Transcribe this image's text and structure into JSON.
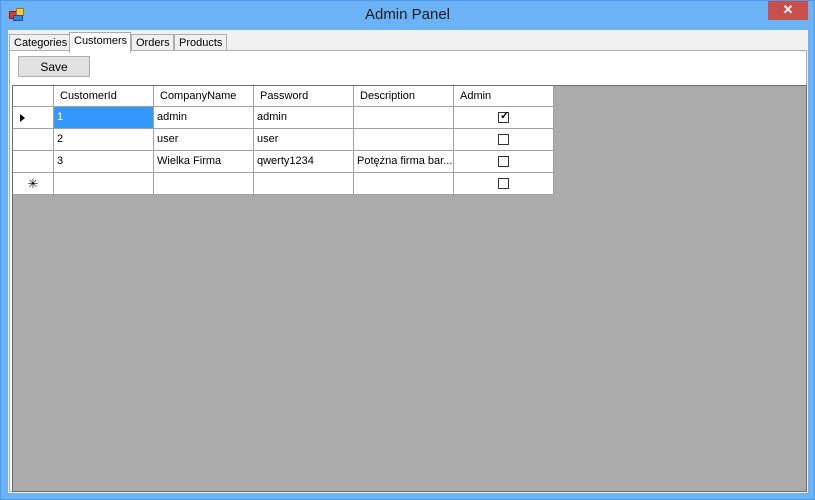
{
  "window": {
    "title": "Admin Panel",
    "close_glyph": "✕"
  },
  "tabs": [
    {
      "label": "Categories"
    },
    {
      "label": "Customers"
    },
    {
      "label": "Orders"
    },
    {
      "label": "Products"
    }
  ],
  "active_tab": "Customers",
  "toolbar": {
    "save_label": "Save"
  },
  "grid": {
    "columns": [
      "CustomerId",
      "CompanyName",
      "Password",
      "Description",
      "Admin"
    ],
    "rows": [
      {
        "CustomerId": "1",
        "CompanyName": "admin",
        "Password": "admin",
        "Description": "",
        "Admin": true,
        "current": true
      },
      {
        "CustomerId": "2",
        "CompanyName": "user",
        "Password": "user",
        "Description": "",
        "Admin": false
      },
      {
        "CustomerId": "3",
        "CompanyName": "Wielka Firma",
        "Password": "qwerty1234",
        "Description": "Potężna firma bar...",
        "Admin": false
      }
    ],
    "new_row_glyph": "✳",
    "check_glyph": "✓"
  },
  "colors": {
    "titlebar": "#6cb3f5",
    "selection": "#3399ff",
    "grid_background": "#ababab"
  }
}
